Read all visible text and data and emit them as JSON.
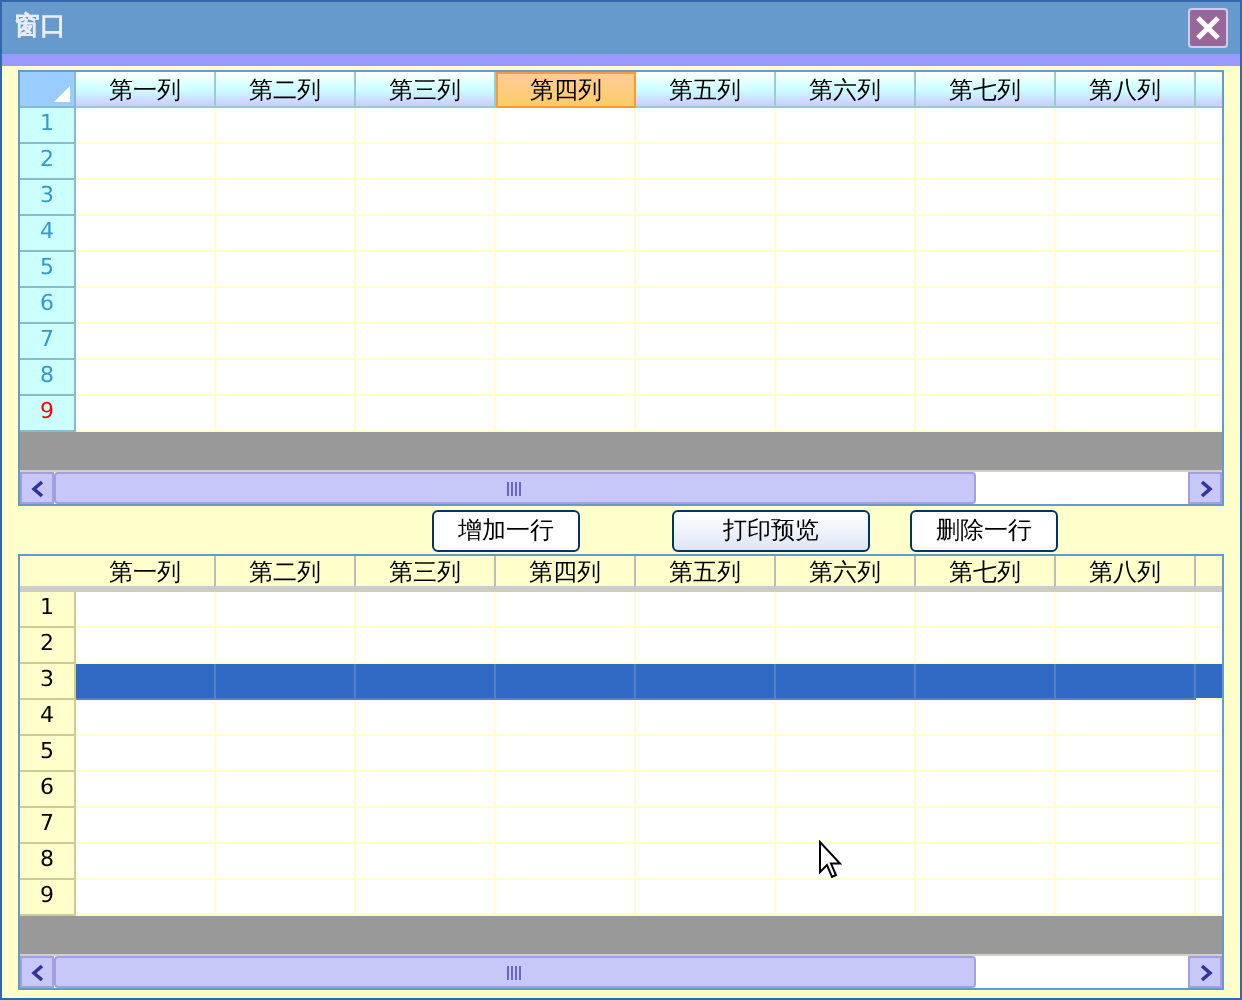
{
  "window": {
    "title": "窗口"
  },
  "top_grid": {
    "columns": [
      {
        "label": "第一列",
        "selected": false
      },
      {
        "label": "第二列",
        "selected": false
      },
      {
        "label": "第三列",
        "selected": false
      },
      {
        "label": "第四列",
        "selected": true
      },
      {
        "label": "第五列",
        "selected": false
      },
      {
        "label": "第六列",
        "selected": false
      },
      {
        "label": "第七列",
        "selected": false
      },
      {
        "label": "第八列",
        "selected": false
      }
    ],
    "rows": [
      {
        "label": "1",
        "current": false
      },
      {
        "label": "2",
        "current": false
      },
      {
        "label": "3",
        "current": false
      },
      {
        "label": "4",
        "current": false
      },
      {
        "label": "5",
        "current": false
      },
      {
        "label": "6",
        "current": false
      },
      {
        "label": "7",
        "current": false
      },
      {
        "label": "8",
        "current": false
      },
      {
        "label": "9",
        "current": true
      }
    ]
  },
  "buttons": [
    "增加一行",
    "打印预览",
    "删除一行"
  ],
  "bottom_grid": {
    "columns": [
      "第一列",
      "第二列",
      "第三列",
      "第四列",
      "第五列",
      "第六列",
      "第七列",
      "第八列"
    ],
    "rows": [
      {
        "label": "1",
        "selected": false
      },
      {
        "label": "2",
        "selected": false
      },
      {
        "label": "3",
        "selected": true
      },
      {
        "label": "4",
        "selected": false
      },
      {
        "label": "5",
        "selected": false
      },
      {
        "label": "6",
        "selected": false
      },
      {
        "label": "7",
        "selected": false
      },
      {
        "label": "8",
        "selected": false
      },
      {
        "label": "9",
        "selected": false
      }
    ]
  }
}
